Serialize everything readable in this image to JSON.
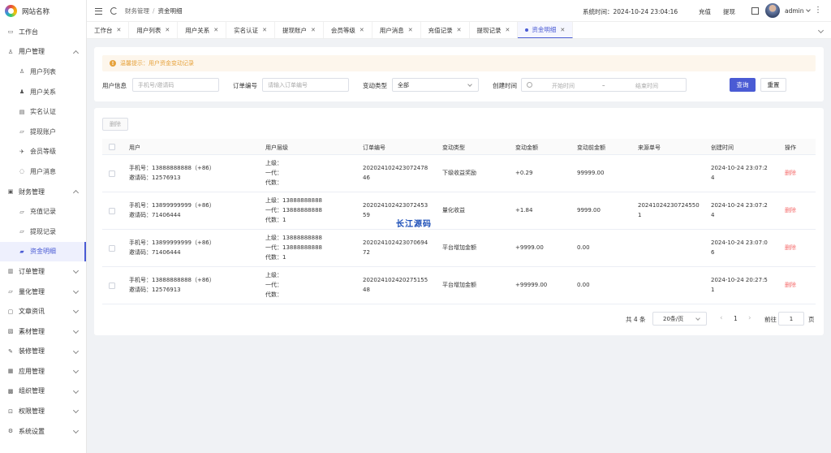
{
  "site": {
    "name": "网站名称"
  },
  "sidebar": {
    "items": [
      {
        "label": "工作台",
        "icon": "monitor-icon",
        "level": 0
      },
      {
        "label": "用户管理",
        "icon": "user-icon",
        "level": 0,
        "expanded": true
      },
      {
        "label": "用户列表",
        "icon": "user-icon",
        "level": 1
      },
      {
        "label": "用户关系",
        "icon": "users-icon",
        "level": 1
      },
      {
        "label": "实名认证",
        "icon": "id-card-icon",
        "level": 1
      },
      {
        "label": "提现账户",
        "icon": "folder-icon",
        "level": 1
      },
      {
        "label": "会员等级",
        "icon": "rocket-icon",
        "level": 1
      },
      {
        "label": "用户消息",
        "icon": "message-icon",
        "level": 1
      },
      {
        "label": "财务管理",
        "icon": "wallet-icon",
        "level": 0,
        "expanded": true
      },
      {
        "label": "充值记录",
        "icon": "folder-icon",
        "level": 1
      },
      {
        "label": "提现记录",
        "icon": "folder-icon",
        "level": 1
      },
      {
        "label": "资金明细",
        "icon": "thumb-icon",
        "level": 1,
        "active": true
      },
      {
        "label": "订单管理",
        "icon": "order-icon",
        "level": 0
      },
      {
        "label": "量化管理",
        "icon": "folder-icon",
        "level": 0
      },
      {
        "label": "文章资讯",
        "icon": "chat-icon",
        "level": 0
      },
      {
        "label": "素材管理",
        "icon": "image-icon",
        "level": 0
      },
      {
        "label": "装修管理",
        "icon": "brush-icon",
        "level": 0
      },
      {
        "label": "应用管理",
        "icon": "app-icon",
        "level": 0
      },
      {
        "label": "组织管理",
        "icon": "org-icon",
        "level": 0
      },
      {
        "label": "权限管理",
        "icon": "lock-icon",
        "level": 0
      },
      {
        "label": "系统设置",
        "icon": "gear-icon",
        "level": 0
      }
    ]
  },
  "header": {
    "breadcrumb": [
      "财务管理",
      "资金明细"
    ],
    "breadcrumb_sep": "/",
    "system_time": "系统时间：2024-10-24 23:04:16",
    "recharge": "充值",
    "withdraw": "提现",
    "username": "admin"
  },
  "tabs": [
    {
      "label": "工作台"
    },
    {
      "label": "用户列表"
    },
    {
      "label": "用户关系"
    },
    {
      "label": "实名认证"
    },
    {
      "label": "提现账户"
    },
    {
      "label": "会员等级"
    },
    {
      "label": "用户消息"
    },
    {
      "label": "充值记录"
    },
    {
      "label": "提现记录"
    },
    {
      "label": "资金明细",
      "active": true
    }
  ],
  "notice": {
    "text": "温馨提示：用户资金变动记录"
  },
  "filters": {
    "user_label": "用户信息",
    "user_placeholder": "手机号/邀请码",
    "order_label": "订单编号",
    "order_placeholder": "请输入订单编号",
    "type_label": "变动类型",
    "type_value": "全部",
    "date_label": "创建时间",
    "date_start": "开始时间",
    "date_sep": "–",
    "date_end": "结束时间",
    "search": "查询",
    "reset": "重置"
  },
  "table": {
    "delete_button": "删除",
    "columns": [
      "用户",
      "用户层级",
      "订单编号",
      "变动类型",
      "变动金额",
      "变动前金额",
      "来源单号",
      "创建时间",
      "操作"
    ],
    "rows": [
      {
        "user": [
          "手机号：13888888888（+86）",
          "邀请码：12576913"
        ],
        "level": [
          "上级：",
          "一代：",
          "代数："
        ],
        "order": [
          "202024102423072478",
          "46"
        ],
        "type": "下级收益奖励",
        "amount": "+0.29",
        "before": "99999.00",
        "source": [
          "",
          ""
        ],
        "time": [
          "2024-10-24 23:07:2",
          "4"
        ],
        "action": "删除"
      },
      {
        "user": [
          "手机号：13899999999（+86）",
          "邀请码：71406444"
        ],
        "level": [
          "上级：13888888888",
          "一代：13888888888",
          "代数：1"
        ],
        "order": [
          "202024102423072453",
          "59"
        ],
        "type": "量化收益",
        "amount": "+1.84",
        "before": "9999.00",
        "source": [
          "20241024230724550",
          "1"
        ],
        "time": [
          "2024-10-24 23:07:2",
          "4"
        ],
        "action": "删除"
      },
      {
        "user": [
          "手机号：13899999999（+86）",
          "邀请码：71406444"
        ],
        "level": [
          "上级：13888888888",
          "一代：13888888888",
          "代数：1"
        ],
        "order": [
          "202024102423070694",
          "72"
        ],
        "type": "平台增加金额",
        "amount": "+9999.00",
        "before": "0.00",
        "source": [
          "",
          ""
        ],
        "time": [
          "2024-10-24 23:07:0",
          "6"
        ],
        "action": "删除"
      },
      {
        "user": [
          "手机号：13888888888（+86）",
          "邀请码：12576913"
        ],
        "level": [
          "上级：",
          "一代：",
          "代数："
        ],
        "order": [
          "202024102420275155",
          "48"
        ],
        "type": "平台增加金额",
        "amount": "+99999.00",
        "before": "0.00",
        "source": [
          "",
          ""
        ],
        "time": [
          "2024-10-24 20:27:5",
          "1"
        ],
        "action": "删除"
      }
    ]
  },
  "pagination": {
    "total": "共 4 条",
    "page_size": "20条/页",
    "current": "1",
    "goto_label": "前往",
    "goto_value": "1",
    "page_unit": "页",
    "prev": "‹",
    "next": "›"
  },
  "watermark": {
    "text": "长江源码"
  },
  "colors": {
    "primary": "#4a5bd4",
    "danger": "#f56c6c",
    "warning": "#e6a23c"
  }
}
